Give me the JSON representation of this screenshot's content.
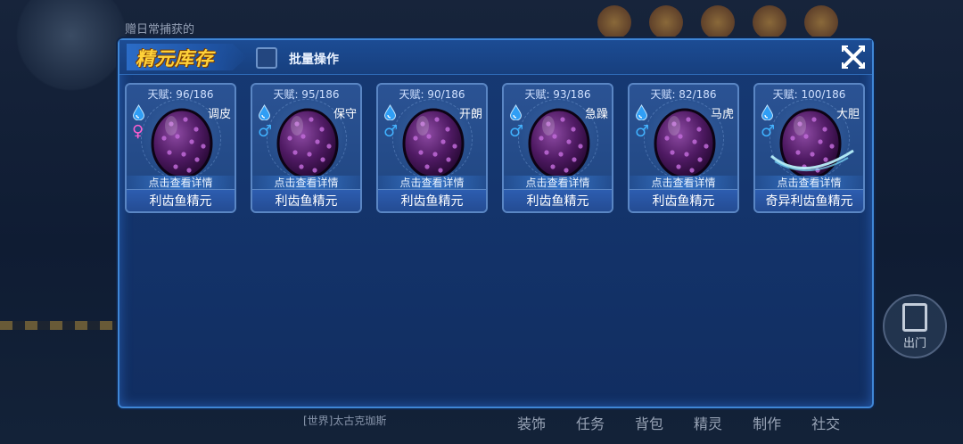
{
  "modal": {
    "title": "精元库存",
    "batch_label": "批量操作"
  },
  "cards": [
    {
      "talent": "天赋: 96/186",
      "gender": "♀",
      "gender_type": "female",
      "trait": "调皮",
      "details": "点击查看详情",
      "name": "利齿鱼精元",
      "special": false
    },
    {
      "talent": "天赋: 95/186",
      "gender": "♂",
      "gender_type": "male",
      "trait": "保守",
      "details": "点击查看详情",
      "name": "利齿鱼精元",
      "special": false
    },
    {
      "talent": "天赋: 90/186",
      "gender": "♂",
      "gender_type": "male",
      "trait": "开朗",
      "details": "点击查看详情",
      "name": "利齿鱼精元",
      "special": false
    },
    {
      "talent": "天赋: 93/186",
      "gender": "♂",
      "gender_type": "male",
      "trait": "急躁",
      "details": "点击查看详情",
      "name": "利齿鱼精元",
      "special": false
    },
    {
      "talent": "天赋: 82/186",
      "gender": "♂",
      "gender_type": "male",
      "trait": "马虎",
      "details": "点击查看详情",
      "name": "利齿鱼精元",
      "special": false
    },
    {
      "talent": "天赋: 100/186",
      "gender": "♂",
      "gender_type": "male",
      "trait": "大胆",
      "details": "点击查看详情",
      "name": "奇异利齿鱼精元",
      "special": true
    }
  ],
  "background": {
    "top_title": "赠日常捕获的",
    "exit_label": "出门",
    "chat": "[世界]太古克珈斯",
    "bottom_nav": [
      "装饰",
      "任务",
      "背包",
      "精灵",
      "制作",
      "社交"
    ]
  },
  "colors": {
    "modal_border": "#3f86d6",
    "title": "#ffd23a",
    "egg": "#5a1f6e",
    "female": "#ff5fd0",
    "male": "#3fb2ff"
  }
}
